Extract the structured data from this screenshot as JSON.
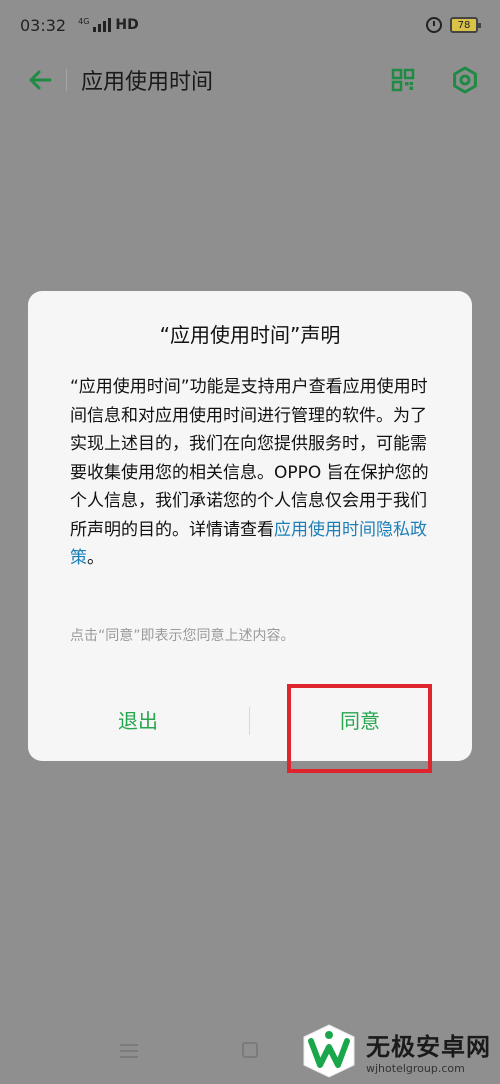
{
  "status_bar": {
    "time": "03:32",
    "network_tag": "4G",
    "hd_label": "HD",
    "battery_level": "78"
  },
  "toolbar": {
    "title": "应用使用时间"
  },
  "dialog": {
    "title": "“应用使用时间”声明",
    "body_text": "“应用使用时间”功能是支持用户查看应用使用时间信息和对应用使用时间进行管理的软件。为了实现上述目的，我们在向您提供服务时，可能需要收集使用您的相关信息。OPPO 旨在保护您的个人信息，我们承诺您的个人信息仅会用于我们所声明的目的。详情请查看",
    "policy_link": "应用使用时间隐私政策",
    "body_end": "。",
    "hint": "点击“同意”即表示您同意上述内容。",
    "exit_label": "退出",
    "agree_label": "同意"
  },
  "watermark": {
    "name": "无极安卓网",
    "url": "wjhotelgroup.com"
  },
  "colors": {
    "accent_green": "#27a54f",
    "link_blue": "#1d7fb8",
    "highlight_red": "#e0242d"
  }
}
